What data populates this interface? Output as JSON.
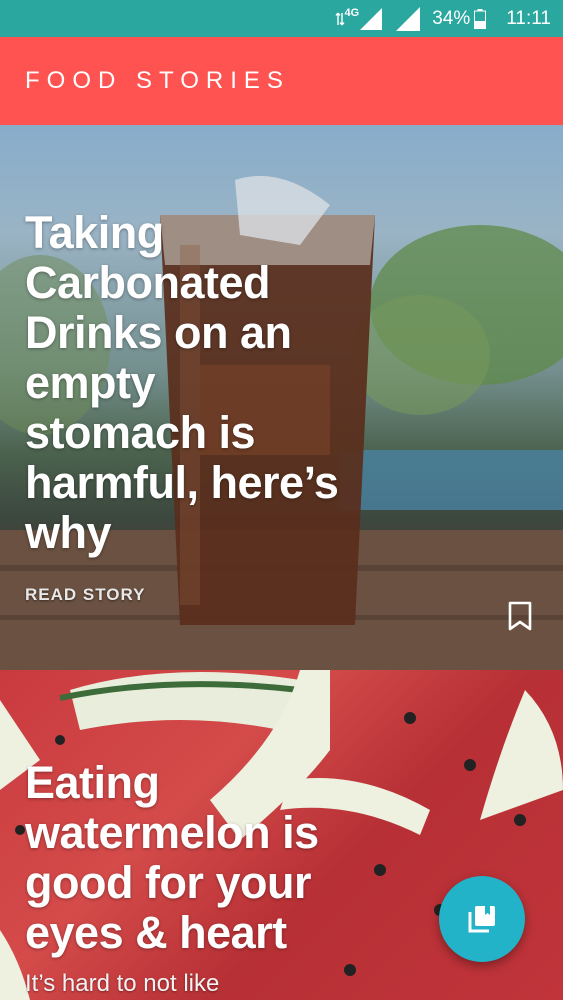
{
  "status_bar": {
    "network_label": "4G",
    "battery_percent": "34%",
    "time": "11:11"
  },
  "app_bar": {
    "title": "FOOD STORIES"
  },
  "stories": [
    {
      "title": "Taking\nCarbonated\nDrinks on an\nempty\nstomach is\nharmful, here’s\nwhy",
      "read_label": "READ STORY",
      "bookmark_icon": "bookmark-outline-icon"
    },
    {
      "title": "Eating\nwatermelon is\ngood for your\neyes & heart",
      "excerpt": "It’s hard to not like"
    }
  ],
  "fab": {
    "icon": "collections-bookmark-icon",
    "color": "#22b3c9"
  },
  "colors": {
    "status_bar": "#2aa79f",
    "app_bar": "#fe5350"
  }
}
